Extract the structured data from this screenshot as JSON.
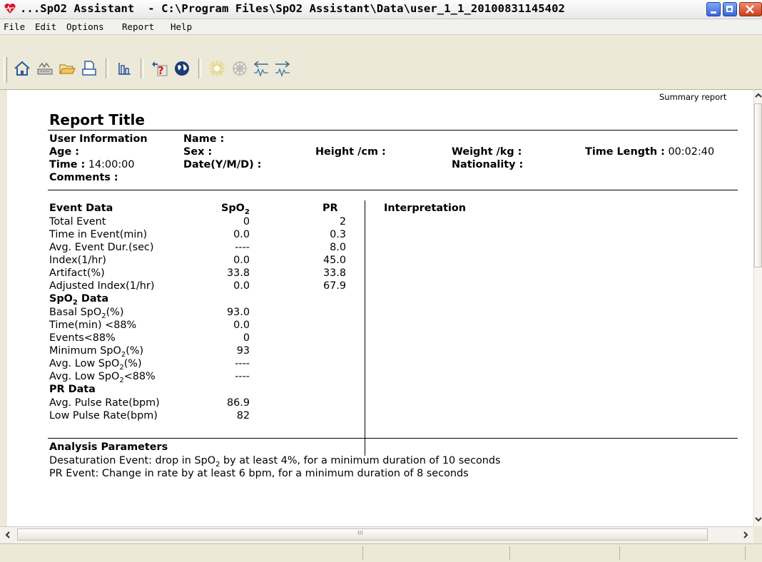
{
  "window": {
    "title": "...SpO2 Assistant  - C:\\Program Files\\SpO2 Assistant\\Data\\user_1_1_20100831145402"
  },
  "menu": {
    "items": [
      {
        "label": "File"
      },
      {
        "label": "Edit"
      },
      {
        "label": "Options"
      },
      {
        "label": "Report"
      },
      {
        "label": "Help"
      }
    ]
  },
  "toolbar": {
    "icons": [
      "home-icon",
      "device-icon",
      "open-folder-icon",
      "print-icon",
      "chart-bars-icon",
      "help-icon",
      "globe-icon",
      "sun-icon",
      "snowflake-icon",
      "import-icon",
      "export-icon"
    ]
  },
  "report": {
    "summary_label": "Summary report",
    "title": "Report Title",
    "user_info": {
      "heading": "User Information",
      "name_label": "Name :",
      "age_label": "Age :",
      "sex_label": "Sex :",
      "height_label": "Height /cm :",
      "weight_label": "Weight /kg :",
      "time_length_label": "Time Length :",
      "time_length_value": "00:02:40",
      "time_label": "Time :",
      "time_value": "14:00:00",
      "date_label": "Date(Y/M/D) :",
      "nationality_label": "Nationality :",
      "comments_label": "Comments :"
    },
    "event_table": {
      "heading": "Event Data",
      "col_spo2_main": "SpO",
      "col_spo2_sub": "2",
      "col_pr": "PR",
      "interpretation": "Interpretation",
      "rows": [
        {
          "label": "Total Event",
          "spo2": "0",
          "pr": "2"
        },
        {
          "label": "Time in Event(min)",
          "spo2": "0.0",
          "pr": "0.3"
        },
        {
          "label": "Avg. Event Dur.(sec)",
          "spo2": "----",
          "pr": "8.0"
        },
        {
          "label": "Index(1/hr)",
          "spo2": "0.0",
          "pr": "45.0"
        },
        {
          "label": "Artifact(%)",
          "spo2": "33.8",
          "pr": "33.8"
        },
        {
          "label": "Adjusted Index(1/hr)",
          "spo2": "0.0",
          "pr": "67.9"
        }
      ]
    },
    "spo2_data": {
      "heading_main": "SpO",
      "heading_sub": "2",
      "heading_rest": " Data",
      "rows": [
        {
          "pre": "Basal SpO",
          "sub": "2",
          "post": "(%)",
          "value": "93.0"
        },
        {
          "pre": "Time(min) <88%",
          "sub": "",
          "post": "",
          "value": "0.0"
        },
        {
          "pre": "Events<88%",
          "sub": "",
          "post": "",
          "value": "0"
        },
        {
          "pre": "Minimum SpO",
          "sub": "2",
          "post": "(%)",
          "value": "93"
        },
        {
          "pre": "Avg. Low SpO",
          "sub": "2",
          "post": "(%)",
          "value": "----"
        },
        {
          "pre": "Avg. Low SpO",
          "sub": "2",
          "post": "<88%",
          "value": "----"
        }
      ]
    },
    "pr_data": {
      "heading": "PR Data",
      "rows": [
        {
          "label": "Avg. Pulse Rate(bpm)",
          "value": "86.9"
        },
        {
          "label": "Low Pulse Rate(bpm)",
          "value": "82"
        }
      ]
    },
    "analysis": {
      "heading": "Analysis Parameters",
      "desat_pre": "Desaturation Event: drop in SpO",
      "desat_sub": "2",
      "desat_post": " by at least 4%,  for a minimum duration of 10 seconds",
      "pr_event": "PR Event: Change in rate by at least 6 bpm, for a minimum duration of 8 seconds"
    }
  },
  "scroll": {
    "hscroll_grip": "III"
  }
}
